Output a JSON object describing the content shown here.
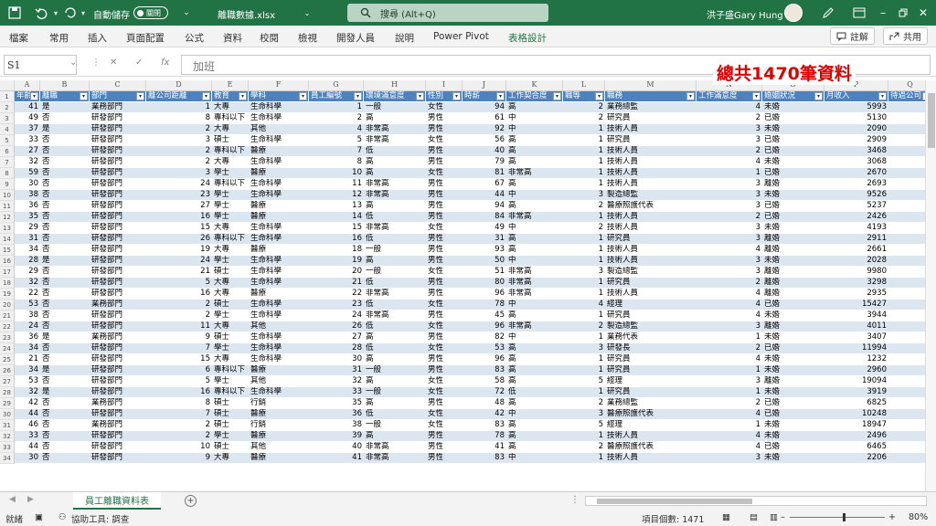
{
  "titlebar": {
    "autosave_label": "自動儲存",
    "autosave_state": "關閉",
    "filename": "離職數據.xlsx",
    "search_placeholder": "搜尋 (Alt+Q)",
    "user_name": "洪子盛Gary Hung",
    "accent_color": "#217346"
  },
  "ribbon": {
    "tabs": [
      "檔案",
      "常用",
      "插入",
      "頁面配置",
      "公式",
      "資料",
      "校閱",
      "檢視",
      "開發人員",
      "說明",
      "Power Pivot",
      "表格設計"
    ],
    "comment_button": "註解",
    "share_button": "共用"
  },
  "formula": {
    "name_box": "S1",
    "fx": "fx",
    "value": "加班"
  },
  "annotation": "總共1470筆資料",
  "columns": [
    "A",
    "B",
    "C",
    "D",
    "E",
    "F",
    "G",
    "H",
    "I",
    "J",
    "K",
    "L",
    "M",
    "N",
    "O",
    "P",
    "Q"
  ],
  "row_numbers": [
    1,
    2,
    3,
    4,
    5,
    6,
    7,
    8,
    9,
    10,
    11,
    12,
    13,
    14,
    15,
    16,
    17,
    18,
    19,
    20,
    21,
    22,
    23,
    24,
    25,
    26,
    27,
    28,
    29,
    30,
    31,
    32,
    33,
    34
  ],
  "table": {
    "headers": [
      "年齡",
      "離職",
      "部門",
      "離公司距離",
      "教育",
      "學科",
      "員工編號",
      "環境滿意度",
      "性別",
      "時薪",
      "工作契合度",
      "職等",
      "職務",
      "工作滿意度",
      "婚姻狀況",
      "月收入",
      "待過公司"
    ],
    "rows": [
      [
        "41",
        "是",
        "業務部門",
        "1",
        "大專",
        "生命科學",
        "1",
        "一般",
        "女性",
        "94",
        "高",
        "2",
        "業務總監",
        "4",
        "未婚",
        "5993"
      ],
      [
        "49",
        "否",
        "研發部門",
        "8",
        "專科以下",
        "生命科學",
        "2",
        "高",
        "男性",
        "61",
        "中",
        "2",
        "研究員",
        "2",
        "已婚",
        "5130"
      ],
      [
        "37",
        "是",
        "研發部門",
        "2",
        "大專",
        "其他",
        "4",
        "非常高",
        "男性",
        "92",
        "中",
        "1",
        "技術人員",
        "3",
        "未婚",
        "2090"
      ],
      [
        "33",
        "否",
        "研發部門",
        "3",
        "碩士",
        "生命科學",
        "5",
        "非常高",
        "女性",
        "56",
        "高",
        "1",
        "研究員",
        "3",
        "已婚",
        "2909"
      ],
      [
        "27",
        "否",
        "研發部門",
        "2",
        "專科以下",
        "醫療",
        "7",
        "低",
        "男性",
        "40",
        "高",
        "1",
        "技術人員",
        "2",
        "已婚",
        "3468"
      ],
      [
        "32",
        "否",
        "研發部門",
        "2",
        "大專",
        "生命科學",
        "8",
        "高",
        "男性",
        "79",
        "高",
        "1",
        "技術人員",
        "4",
        "未婚",
        "3068"
      ],
      [
        "59",
        "否",
        "研發部門",
        "3",
        "學士",
        "醫療",
        "10",
        "高",
        "女性",
        "81",
        "非常高",
        "1",
        "技術人員",
        "1",
        "已婚",
        "2670"
      ],
      [
        "30",
        "否",
        "研發部門",
        "24",
        "專科以下",
        "生命科學",
        "11",
        "非常高",
        "男性",
        "67",
        "高",
        "1",
        "技術人員",
        "3",
        "離婚",
        "2693"
      ],
      [
        "38",
        "否",
        "研發部門",
        "23",
        "學士",
        "生命科學",
        "12",
        "非常高",
        "男性",
        "44",
        "中",
        "3",
        "製造總監",
        "3",
        "未婚",
        "9526"
      ],
      [
        "36",
        "否",
        "研發部門",
        "27",
        "學士",
        "醫療",
        "13",
        "高",
        "男性",
        "94",
        "高",
        "2",
        "醫療照護代表",
        "3",
        "已婚",
        "5237"
      ],
      [
        "35",
        "否",
        "研發部門",
        "16",
        "學士",
        "醫療",
        "14",
        "低",
        "男性",
        "84",
        "非常高",
        "1",
        "技術人員",
        "2",
        "已婚",
        "2426"
      ],
      [
        "29",
        "否",
        "研發部門",
        "15",
        "大專",
        "生命科學",
        "15",
        "非常高",
        "女性",
        "49",
        "中",
        "2",
        "技術人員",
        "3",
        "未婚",
        "4193"
      ],
      [
        "31",
        "否",
        "研發部門",
        "26",
        "專科以下",
        "生命科學",
        "16",
        "低",
        "男性",
        "31",
        "高",
        "1",
        "研究員",
        "3",
        "離婚",
        "2911"
      ],
      [
        "34",
        "否",
        "研發部門",
        "19",
        "大專",
        "醫療",
        "18",
        "一般",
        "男性",
        "93",
        "高",
        "1",
        "技術人員",
        "4",
        "離婚",
        "2661"
      ],
      [
        "28",
        "是",
        "研發部門",
        "24",
        "學士",
        "生命科學",
        "19",
        "高",
        "男性",
        "50",
        "中",
        "1",
        "技術人員",
        "3",
        "未婚",
        "2028"
      ],
      [
        "29",
        "否",
        "研發部門",
        "21",
        "碩士",
        "生命科學",
        "20",
        "一般",
        "女性",
        "51",
        "非常高",
        "3",
        "製造總監",
        "3",
        "離婚",
        "9980"
      ],
      [
        "32",
        "否",
        "研發部門",
        "5",
        "大專",
        "生命科學",
        "21",
        "低",
        "男性",
        "80",
        "非常高",
        "1",
        "研究員",
        "2",
        "離婚",
        "3298"
      ],
      [
        "22",
        "否",
        "研發部門",
        "16",
        "大專",
        "醫療",
        "22",
        "非常高",
        "男性",
        "96",
        "非常高",
        "1",
        "技術人員",
        "4",
        "離婚",
        "2935"
      ],
      [
        "53",
        "否",
        "業務部門",
        "2",
        "碩士",
        "生命科學",
        "23",
        "低",
        "女性",
        "78",
        "中",
        "4",
        "經理",
        "4",
        "已婚",
        "15427"
      ],
      [
        "38",
        "否",
        "研發部門",
        "2",
        "學士",
        "生命科學",
        "24",
        "非常高",
        "男性",
        "45",
        "高",
        "1",
        "研究員",
        "4",
        "未婚",
        "3944"
      ],
      [
        "24",
        "否",
        "研發部門",
        "11",
        "大專",
        "其他",
        "26",
        "低",
        "女性",
        "96",
        "非常高",
        "2",
        "製造總監",
        "3",
        "離婚",
        "4011"
      ],
      [
        "36",
        "是",
        "業務部門",
        "9",
        "碩士",
        "生命科學",
        "27",
        "高",
        "男性",
        "82",
        "中",
        "1",
        "業務代表",
        "1",
        "未婚",
        "3407"
      ],
      [
        "34",
        "否",
        "研發部門",
        "7",
        "學士",
        "生命科學",
        "28",
        "低",
        "女性",
        "53",
        "高",
        "3",
        "研發長",
        "2",
        "已婚",
        "11994"
      ],
      [
        "21",
        "否",
        "研發部門",
        "15",
        "大專",
        "生命科學",
        "30",
        "高",
        "男性",
        "96",
        "高",
        "1",
        "研究員",
        "4",
        "未婚",
        "1232"
      ],
      [
        "34",
        "是",
        "研發部門",
        "6",
        "專科以下",
        "醫療",
        "31",
        "一般",
        "男性",
        "83",
        "高",
        "1",
        "研究員",
        "1",
        "未婚",
        "2960"
      ],
      [
        "53",
        "否",
        "研發部門",
        "5",
        "學士",
        "其他",
        "32",
        "高",
        "女性",
        "58",
        "高",
        "5",
        "經理",
        "3",
        "離婚",
        "19094"
      ],
      [
        "32",
        "是",
        "研發部門",
        "16",
        "專科以下",
        "生命科學",
        "33",
        "一般",
        "女性",
        "72",
        "低",
        "1",
        "研究員",
        "1",
        "未婚",
        "3919"
      ],
      [
        "42",
        "否",
        "業務部門",
        "8",
        "碩士",
        "行銷",
        "35",
        "高",
        "男性",
        "48",
        "高",
        "2",
        "業務總監",
        "2",
        "已婚",
        "6825"
      ],
      [
        "44",
        "否",
        "研發部門",
        "7",
        "碩士",
        "醫療",
        "36",
        "低",
        "女性",
        "42",
        "中",
        "3",
        "醫療照護代表",
        "4",
        "已婚",
        "10248"
      ],
      [
        "46",
        "否",
        "業務部門",
        "2",
        "碩士",
        "行銷",
        "38",
        "一般",
        "女性",
        "83",
        "高",
        "5",
        "經理",
        "1",
        "未婚",
        "18947"
      ],
      [
        "33",
        "否",
        "研發部門",
        "2",
        "學士",
        "醫療",
        "39",
        "高",
        "男性",
        "78",
        "高",
        "1",
        "技術人員",
        "4",
        "未婚",
        "2496"
      ],
      [
        "44",
        "否",
        "研發部門",
        "10",
        "碩士",
        "其他",
        "40",
        "非常高",
        "男性",
        "41",
        "高",
        "2",
        "醫療照護代表",
        "4",
        "已婚",
        "6465"
      ],
      [
        "30",
        "否",
        "研發部門",
        "9",
        "大專",
        "醫療",
        "41",
        "非常高",
        "男性",
        "83",
        "中",
        "1",
        "技術人員",
        "3",
        "未婚",
        "2206"
      ]
    ]
  },
  "sheet_tab": "員工離職資料表",
  "status": {
    "ready": "就緒",
    "accessibility": "協助工具: 調查",
    "count": "項目個數: 1471",
    "zoom": "80%"
  }
}
